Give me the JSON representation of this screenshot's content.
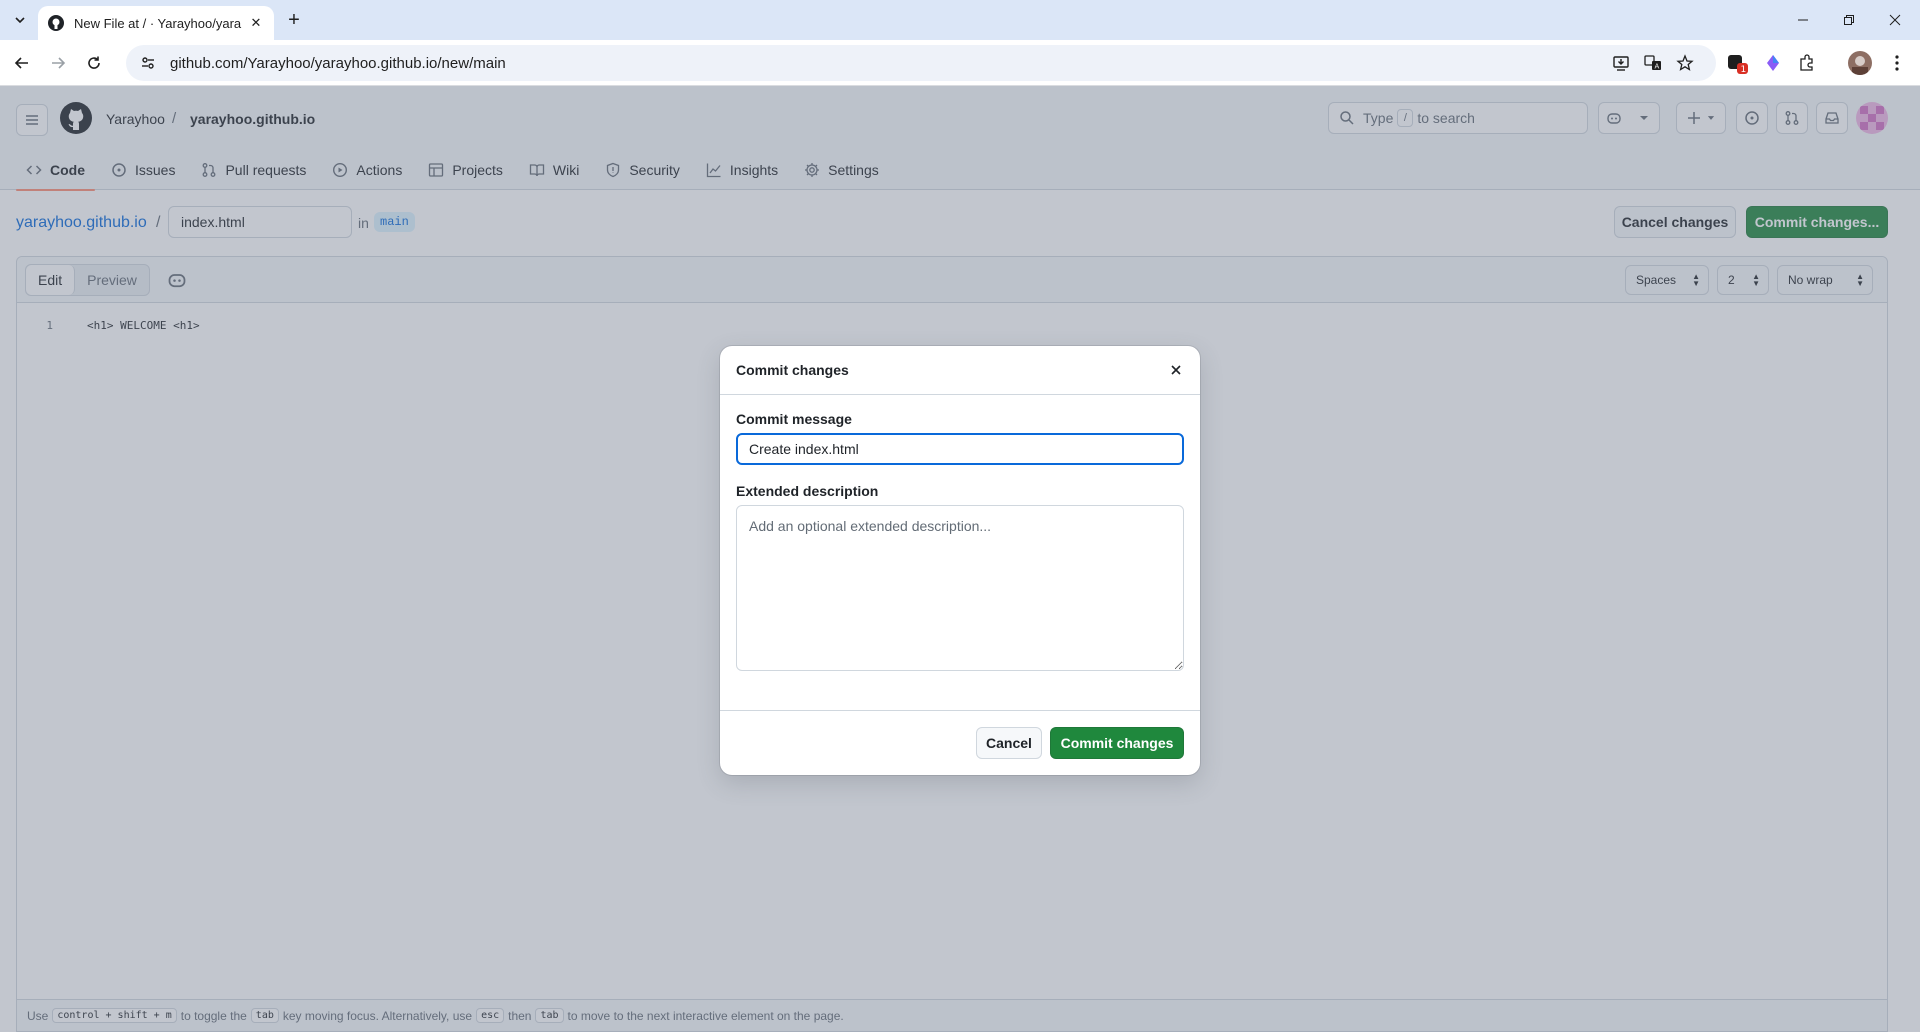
{
  "browser": {
    "tab_title": "New File at / · Yarayhoo/yara",
    "url": "github.com/Yarayhoo/yarayhoo.github.io/new/main",
    "extension_badge": "1"
  },
  "header": {
    "owner": "Yarayhoo",
    "separator": "/",
    "repo": "yarayhoo.github.io",
    "search_prefix": "Type",
    "search_key": "/",
    "search_suffix": "to search"
  },
  "repo_nav": [
    {
      "label": "Code",
      "icon": "code-icon"
    },
    {
      "label": "Issues",
      "icon": "issue-icon"
    },
    {
      "label": "Pull requests",
      "icon": "pull-request-icon"
    },
    {
      "label": "Actions",
      "icon": "play-icon"
    },
    {
      "label": "Projects",
      "icon": "table-icon"
    },
    {
      "label": "Wiki",
      "icon": "book-icon"
    },
    {
      "label": "Security",
      "icon": "shield-icon"
    },
    {
      "label": "Insights",
      "icon": "graph-icon"
    },
    {
      "label": "Settings",
      "icon": "gear-icon"
    }
  ],
  "edit_bar": {
    "repo_link": "yarayhoo.github.io",
    "separator": "/",
    "filename": "index.html",
    "in_text": "in",
    "branch": "main",
    "cancel_label": "Cancel changes",
    "commit_label": "Commit changes..."
  },
  "editor": {
    "tab_edit": "Edit",
    "tab_preview": "Preview",
    "indent_mode": "Spaces",
    "indent_size": "2",
    "wrap_mode": "No wrap",
    "lines": [
      {
        "number": "1",
        "text": "<h1> WELCOME <h1>"
      }
    ],
    "hint": {
      "p1": "Use",
      "k1": "control + shift + m",
      "p2": "to toggle the",
      "k2": "tab",
      "p3": "key moving focus. Alternatively, use",
      "k3": "esc",
      "p4": "then",
      "k4": "tab",
      "p5": "to move to the next interactive element on the page."
    }
  },
  "dialog": {
    "title": "Commit changes",
    "message_label": "Commit message",
    "message_value": "Create index.html",
    "description_label": "Extended description",
    "description_placeholder": "Add an optional extended description...",
    "cancel_label": "Cancel",
    "commit_label": "Commit changes"
  },
  "colors": {
    "primary_green": "#1f883d",
    "link_blue": "#0969da",
    "active_tab_underline": "#fd8c73"
  }
}
